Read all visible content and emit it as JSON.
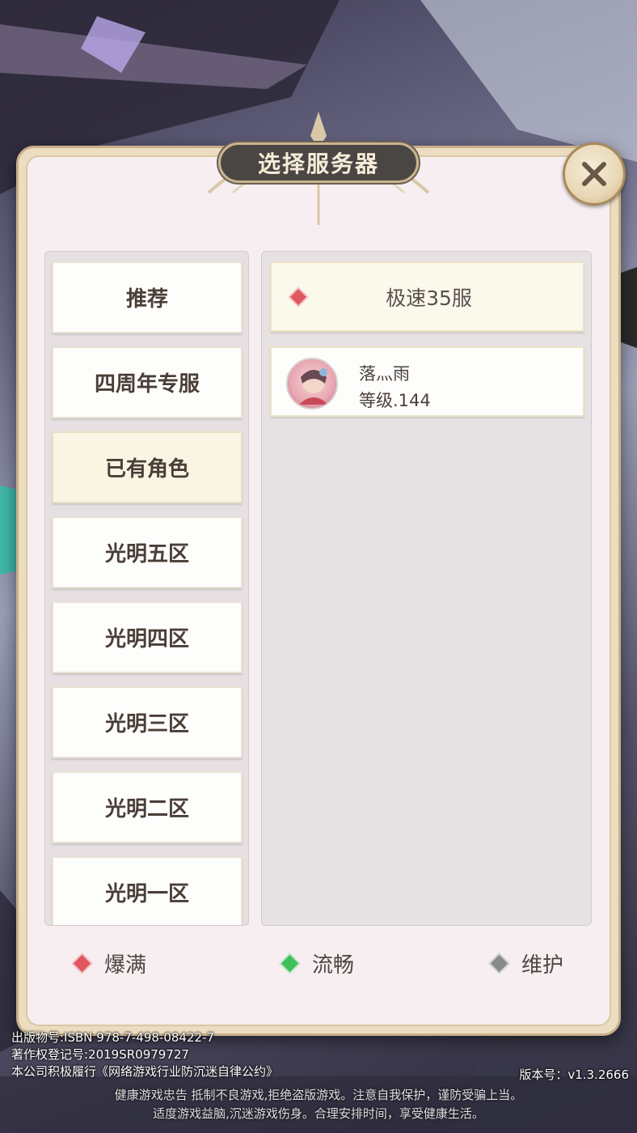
{
  "dialog": {
    "title": "选择服务器",
    "close_icon": "close-icon"
  },
  "categories": [
    {
      "label": "推荐",
      "selected": false
    },
    {
      "label": "四周年专服",
      "selected": false
    },
    {
      "label": "已有角色",
      "selected": true
    },
    {
      "label": "光明五区",
      "selected": false
    },
    {
      "label": "光明四区",
      "selected": false
    },
    {
      "label": "光明三区",
      "selected": false
    },
    {
      "label": "光明二区",
      "selected": false
    },
    {
      "label": "光明一区",
      "selected": false
    }
  ],
  "servers": {
    "current": {
      "name": "极速35服",
      "status_color": "#e0575f"
    },
    "character": {
      "name": "落灬雨",
      "level": "等级.144",
      "avatar_icon": "character-avatar"
    }
  },
  "legend": [
    {
      "label": "爆满",
      "color": "#e0575f"
    },
    {
      "label": "流畅",
      "color": "#3fbf5a"
    },
    {
      "label": "维护",
      "color": "#8a8a8a"
    }
  ],
  "footer": {
    "legal_lines": [
      "出版物号:ISBN 978-7-498-08422-7",
      "著作权登记号:2019SR0979727",
      "本公司积极履行《网络游戏行业防沉迷自律公约》"
    ],
    "version": "版本号：v1.3.2666",
    "health_line1": "健康游戏忠告  抵制不良游戏,拒绝盗版游戏。注意自我保护，谨防受骗上当。",
    "health_line2": "适度游戏益脑,沉迷游戏伤身。合理安排时间，享受健康生活。"
  }
}
